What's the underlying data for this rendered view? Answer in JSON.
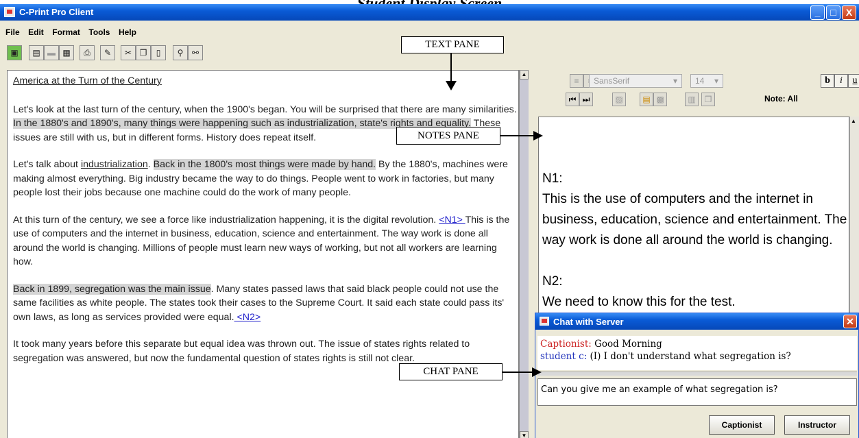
{
  "page_caption": "Student Display Screen",
  "window": {
    "title": "C-Print Pro Client",
    "minimize": "_",
    "maximize": "□",
    "close": "X"
  },
  "menu": [
    "File",
    "Edit",
    "Format",
    "Tools",
    "Help"
  ],
  "labels": {
    "text_pane": "TEXT PANE",
    "notes_pane": "NOTES PANE",
    "chat_pane": "CHAT PANE"
  },
  "text_pane": {
    "heading": "America at the Turn of the Century",
    "p1_a": "Let's look at the last turn of the century, when the 1900's began.  You will be surprised that there are many similarities. ",
    "p1_hl": "In the 1880's and 1890's, many things were happening such as industrialization, state's rights and equality.",
    "p1_b": "  These issues are still with us, but in different forms.  History does repeat itself.",
    "p2_a": "Let's talk about ",
    "p2_u": "industrialization",
    "p2_b": ".  ",
    "p2_hl": "Back in the 1800's most things were made by hand.",
    "p2_c": "  By the 1880's, machines were making almost everything.  Big industry became the way to do things.  People went to work in factories, but many people lost their jobs because one machine could do the work of many people.",
    "p3_a": "At this turn of the century, we see a force like industrialization happening, it is the digital revolution.  ",
    "p3_link": " <N1> ",
    "p3_b": "This is the use of computers and the internet in business, education, science and entertainment.  The way work is done all around the world is changing.  Millions of people must learn new ways of working, but not all workers are learning how.",
    "p4_hl": "Back in 1899, segregation was the main issue",
    "p4_a": ".  Many states passed laws that said black people could not use the same facilities as white people. The states took their cases to the Supreme Court.  It said each state could pass its' own laws, as long as services provided were equal.",
    "p4_link": " <N2> ",
    "p5": "It took many years before this separate but equal idea was thrown out.  The issue of states rights related to segregation was answered, but now the fundamental question of states rights is still not clear."
  },
  "notes_toolbar": {
    "font": "SansSerif",
    "size": "14",
    "bold": "b",
    "italic": "i",
    "underline": "u",
    "note_filter": "Note: All"
  },
  "notes": [
    {
      "label": "N1:",
      "text": "This is the use of computers and the internet in business, education, science and entertainment.  The way work is done all around the world is changing."
    },
    {
      "label": "N2:",
      "text": "We need to know this for the test."
    }
  ],
  "chat": {
    "title": "Chat with Server",
    "messages": [
      {
        "sender": "Captionist:",
        "text": " Good Morning"
      },
      {
        "sender": "student c:",
        "text": " (I) I don't understand what segregation is?"
      }
    ],
    "input_value": "Can you give me an example of what segregation is?",
    "buttons": [
      "Captionist",
      "Instructor"
    ]
  }
}
